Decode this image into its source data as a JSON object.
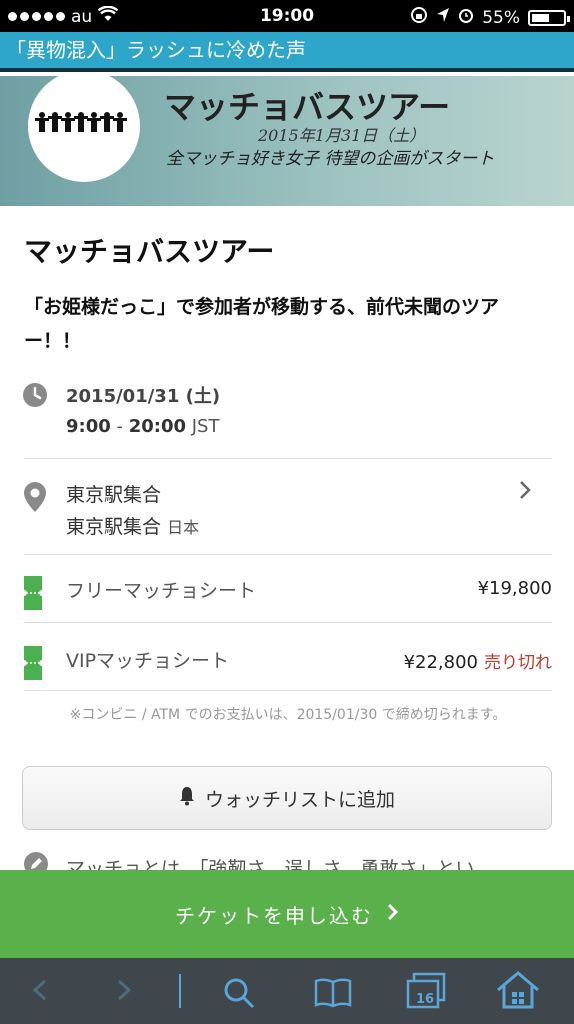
{
  "status": {
    "carrier": "au",
    "time": "19:00",
    "battery": "55%",
    "battery_level": 0.55
  },
  "banner": {
    "text": "「異物混入」ラッシュに冷めた声"
  },
  "hero": {
    "title": "マッチョバスツアー",
    "date": "2015年1月31日（土）",
    "subtitle": "全マッチョ好き女子 待望の企画がスタート"
  },
  "event": {
    "title": "マッチョバスツアー",
    "description": "「お姫様だっこ」で参加者が移動する、前代未聞のツアー！！",
    "date": "2015/01/31 (土)",
    "start": "9:00",
    "dash": " - ",
    "end": "20:00",
    "tz": " JST",
    "location_name": "東京駅集合",
    "location_addr": "東京駅集合",
    "country": "日本"
  },
  "tickets": [
    {
      "name": "フリーマッチョシート",
      "price": "¥19,800",
      "status": ""
    },
    {
      "name": "VIPマッチョシート",
      "price": "¥22,800",
      "status": "売り切れ"
    }
  ],
  "note": "※コンビニ / ATM でのお支払いは、2015/01/30 で締め切られます。",
  "watchlist": {
    "label": "ウォッチリストに追加"
  },
  "partial_text": "マッチョとは、「強靭さ、逞しさ、勇敢さ」とい",
  "cta": {
    "label": "チケットを申し込む"
  },
  "toolbar": {
    "tabs_count": "16"
  },
  "colors": {
    "accent": "#5ab04b",
    "banner": "#2ea6c9",
    "ticket_icon": "#4caf50",
    "sold_out": "#c0392b",
    "toolbar_icon": "#5aa6d8"
  },
  "icons": [
    "clock-icon",
    "map-pin-icon",
    "ticket-icon",
    "bell-icon",
    "pencil-icon",
    "chevron-right-icon",
    "back-icon",
    "forward-icon",
    "search-icon",
    "bookmarks-icon",
    "tabs-icon",
    "home-icon"
  ]
}
